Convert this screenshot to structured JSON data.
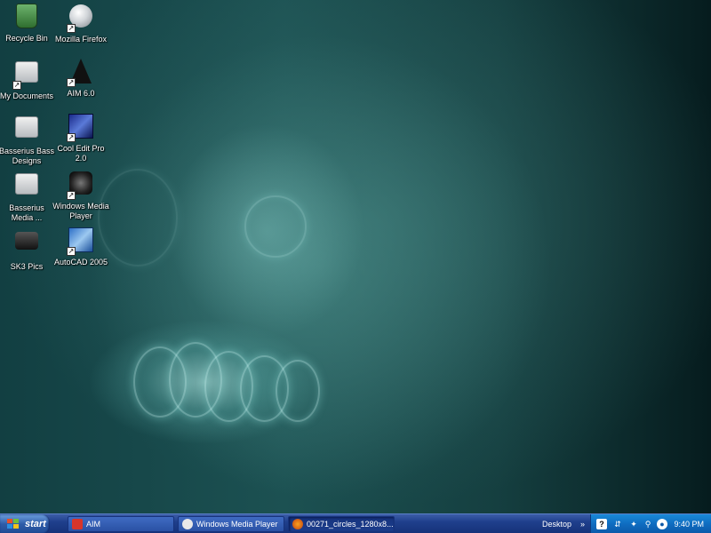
{
  "desktop": {
    "icons": [
      {
        "label": "Recycle Bin",
        "icon": "recycle-bin-icon",
        "shortcut": false
      },
      {
        "label": "Mozilla Firefox",
        "icon": "firefox-icon",
        "shortcut": true
      },
      {
        "label": "My Documents",
        "icon": "folder-icon",
        "shortcut": true
      },
      {
        "label": "AIM 6.0",
        "icon": "aim-icon",
        "shortcut": true
      },
      {
        "label": "Basserius Bass Designs",
        "icon": "folder-icon",
        "shortcut": false
      },
      {
        "label": "Cool Edit Pro 2.0",
        "icon": "cool-edit-icon",
        "shortcut": true
      },
      {
        "label": "Basserius Media ...",
        "icon": "folder-icon",
        "shortcut": false
      },
      {
        "label": "Windows Media Player",
        "icon": "media-player-icon",
        "shortcut": true
      },
      {
        "label": "SK3 Pics",
        "icon": "camera-icon",
        "shortcut": false
      },
      {
        "label": "AutoCAD 2005",
        "icon": "autocad-icon",
        "shortcut": true
      }
    ]
  },
  "taskbar": {
    "start_label": "start",
    "tasks": [
      {
        "label": "AIM",
        "icon": "aim-icon",
        "active": false
      },
      {
        "label": "Windows Media Player",
        "icon": "media-player-icon",
        "active": false
      },
      {
        "label": "00271_circles_1280x8...",
        "icon": "firefox-icon",
        "active": true
      }
    ],
    "desktop_toolbar_label": "Desktop",
    "desktop_toolbar_chevron": "»",
    "clock": "9:40 PM"
  },
  "colors": {
    "taskbar_blue": "#1f3f8c",
    "tray_blue": "#0f6cc0",
    "wallpaper_teal": "#1c5152"
  }
}
